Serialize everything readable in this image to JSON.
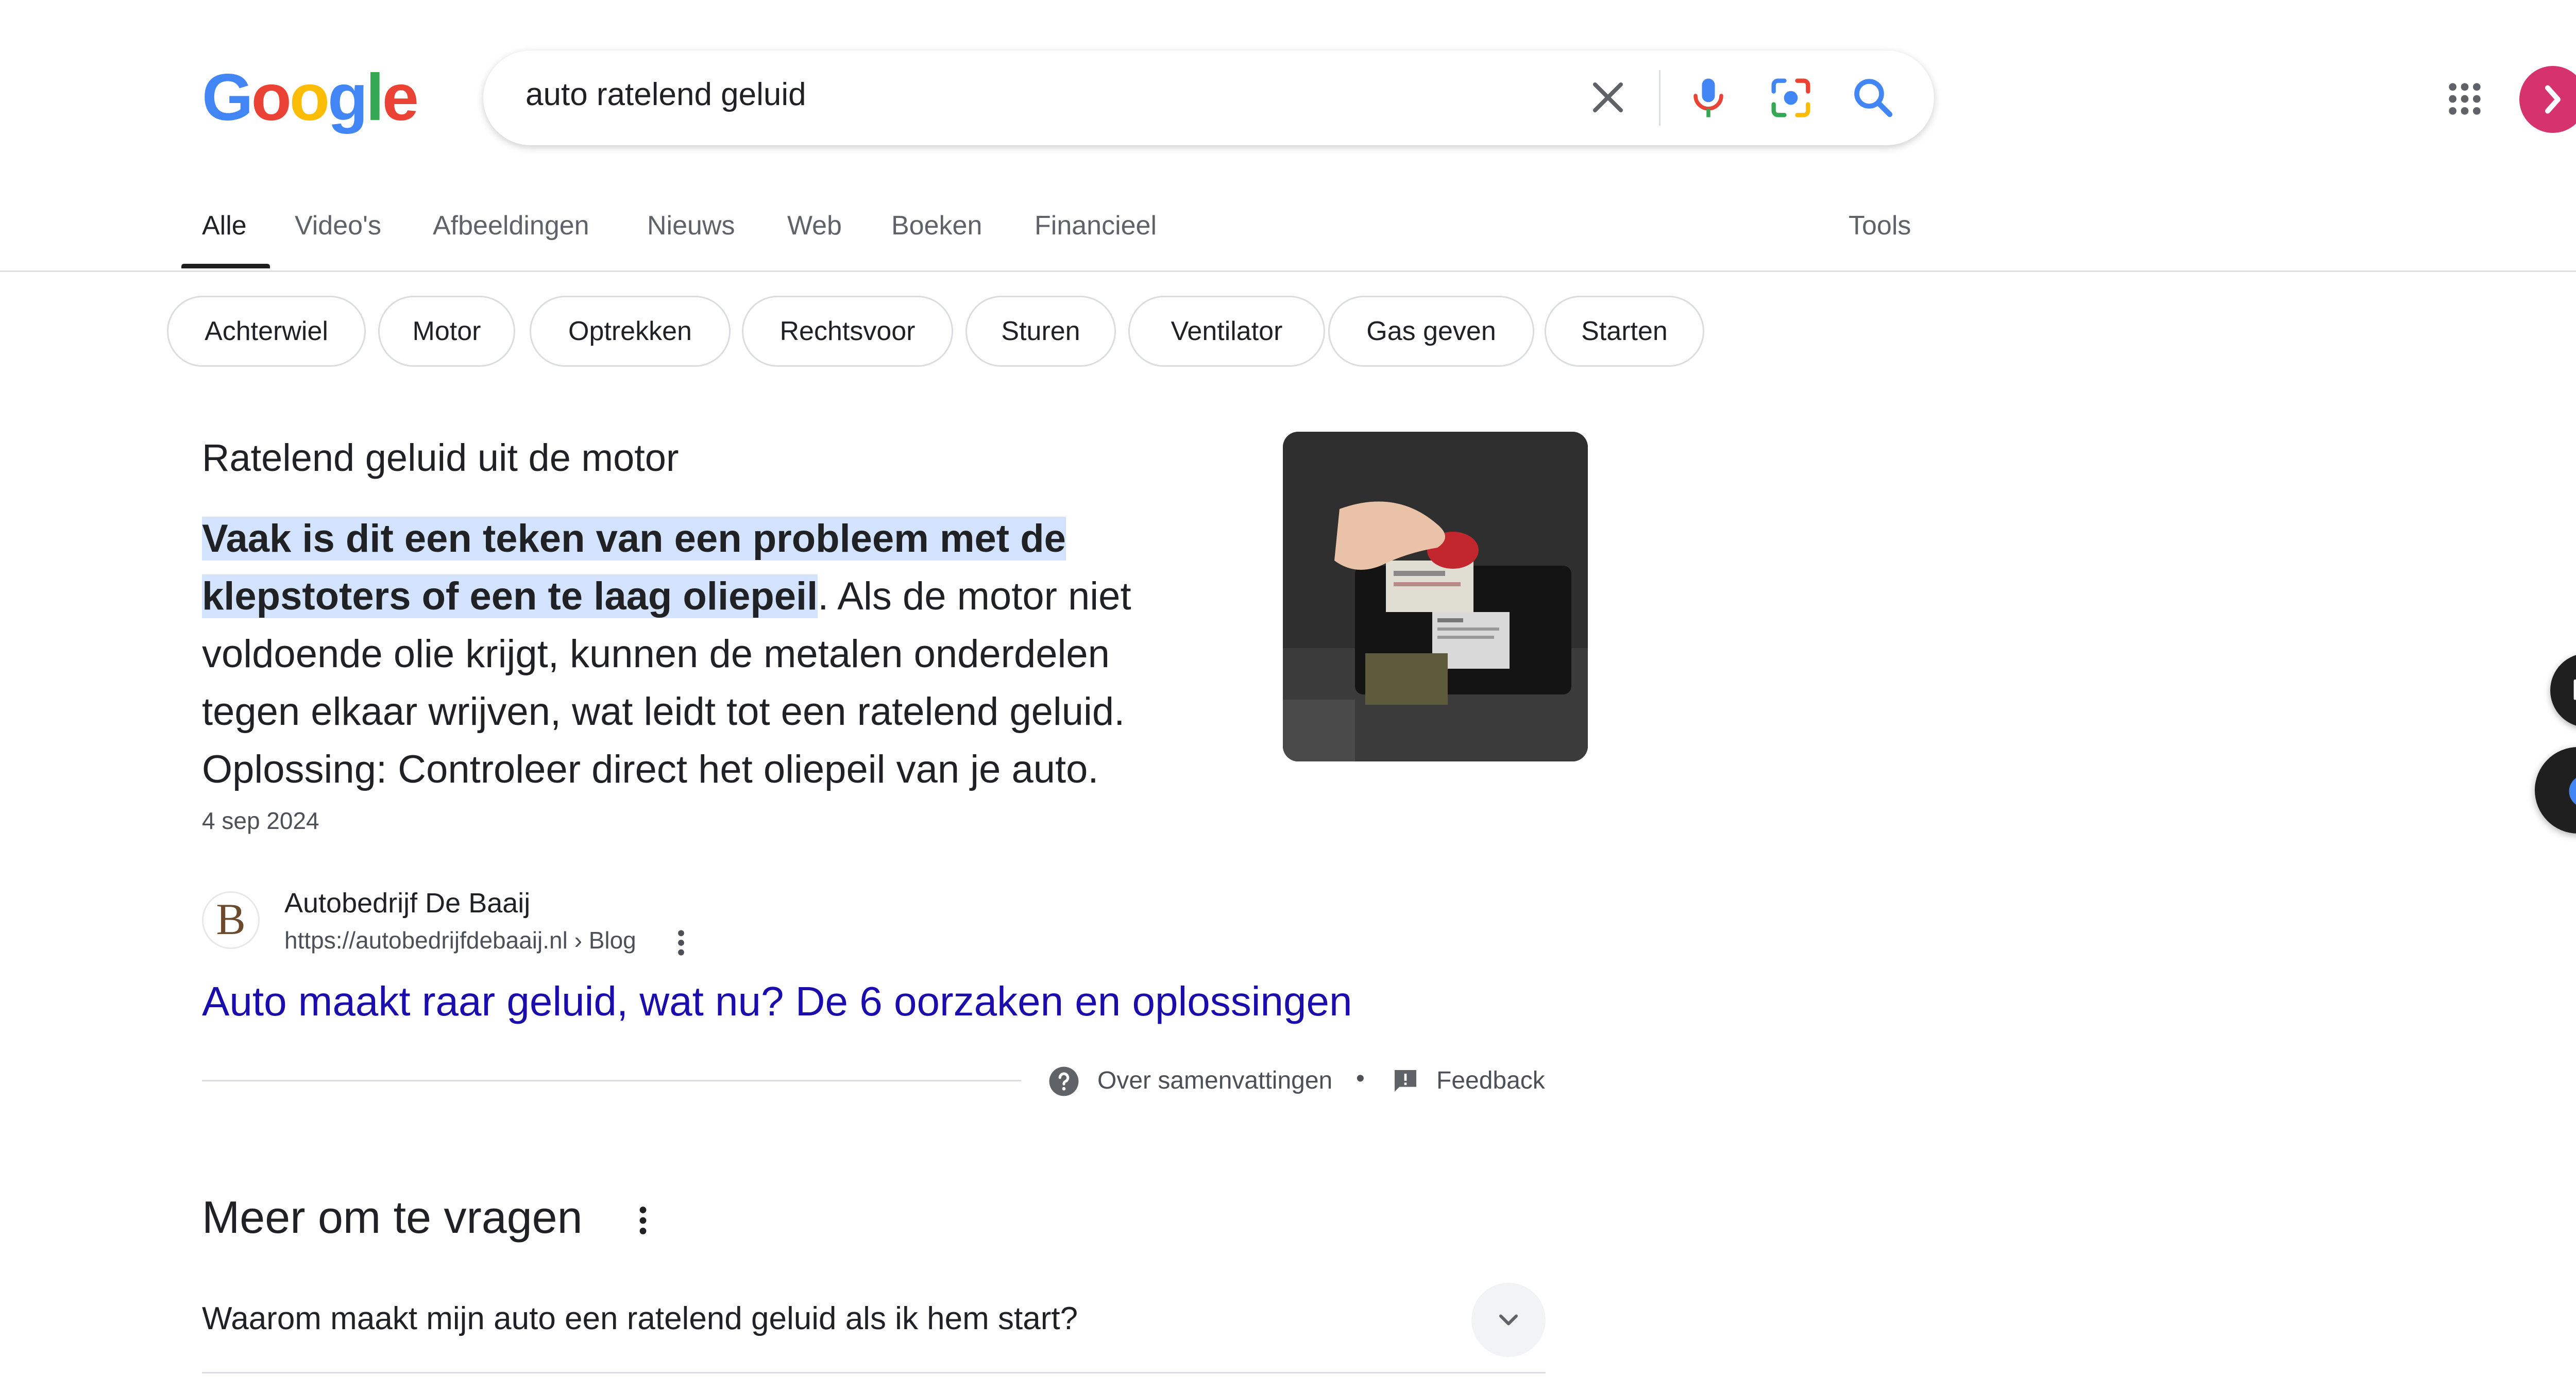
{
  "logo": {
    "letters": [
      {
        "char": "G",
        "color": "#4285F4"
      },
      {
        "char": "o",
        "color": "#EA4335"
      },
      {
        "char": "o",
        "color": "#FBBC05"
      },
      {
        "char": "g",
        "color": "#4285F4"
      },
      {
        "char": "l",
        "color": "#34A853"
      },
      {
        "char": "e",
        "color": "#EA4335"
      }
    ]
  },
  "search": {
    "query": "auto ratelend geluid",
    "icons": [
      "close-icon",
      "mic-icon",
      "lens-icon",
      "search-icon"
    ]
  },
  "header": {
    "apps_icon": "apps-grid-icon",
    "avatar_color": "#d6336c"
  },
  "tabs": [
    {
      "label": "Alle",
      "active": true
    },
    {
      "label": "Video's"
    },
    {
      "label": "Afbeeldingen"
    },
    {
      "label": "Nieuws"
    },
    {
      "label": "Web"
    },
    {
      "label": "Boeken"
    },
    {
      "label": "Financieel"
    }
  ],
  "tools_label": "Tools",
  "chips": [
    "Achterwiel",
    "Motor",
    "Optrekken",
    "Rechtsvoor",
    "Sturen",
    "Ventilator",
    "Gas geven",
    "Starten"
  ],
  "snippet": {
    "heading": "Ratelend geluid uit de motor",
    "line1_hl": "Vaak is dit een teken van een probleem met de",
    "line2_hl": "klepstoters of een te laag oliepeil",
    "line2_rest": ". Als de motor niet",
    "line3": "voldoende olie krijgt, kunnen de metalen onderdelen",
    "line4": "tegen elkaar wrijven, wat leidt tot een ratelend geluid.",
    "line5": "Oplossing: Controleer direct het oliepeil van je auto.",
    "date": "4 sep 2024",
    "highlight_color": "#d3e3fd"
  },
  "source": {
    "name": "Autobedrijf De Baaij",
    "url": "https://autobedrijfdebaaij.nl › Blog",
    "favicon_letter": "B",
    "link_title": "Auto maakt raar geluid, wat nu? De 6 oorzaken en oplossingen",
    "link_color": "#1a0dab"
  },
  "about": {
    "about_label": "Over samenvattingen",
    "bullet": "•",
    "feedback_label": "Feedback"
  },
  "paa": {
    "heading": "Meer om te vragen",
    "question": "Waarom maakt mijn auto een ratelend geluid als ik hem start?"
  }
}
